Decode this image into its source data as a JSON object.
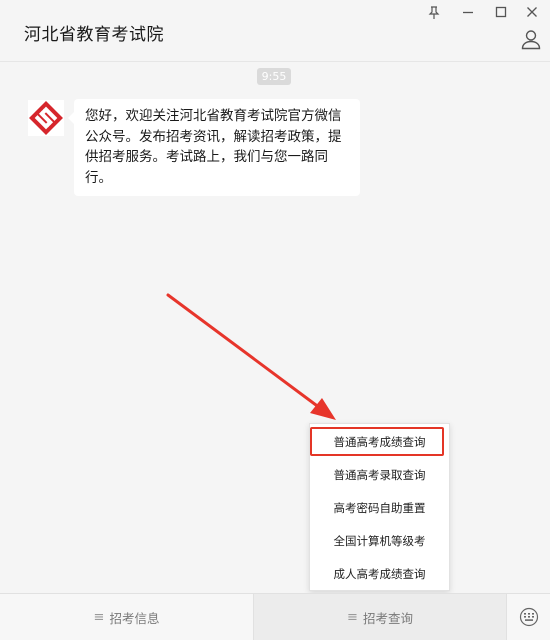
{
  "window": {
    "title": "河北省教育考试院",
    "controls": [
      "pin-icon",
      "minimize-icon",
      "maximize-icon",
      "close-icon"
    ]
  },
  "chat": {
    "timestamp": "9:55",
    "message": "您好，欢迎关注河北省教育考试院官方微信公众号。发布招考资讯，解读招考政策，提供招考服务。考试路上，我们与您一路同行。"
  },
  "popup": {
    "items": [
      {
        "label": "普通高考成绩查询"
      },
      {
        "label": "普通高考录取查询"
      },
      {
        "label": "高考密码自助重置"
      },
      {
        "label": "全国计算机等级考"
      },
      {
        "label": "成人高考成绩查询"
      }
    ],
    "highlighted_index": 0
  },
  "bottom_menu": {
    "left_label": "招考信息",
    "right_label": "招考查询",
    "menu_icon": "≡"
  },
  "colors": {
    "highlight": "#e43526",
    "arrow": "#e7352b",
    "logo_red": "#d6262c"
  }
}
